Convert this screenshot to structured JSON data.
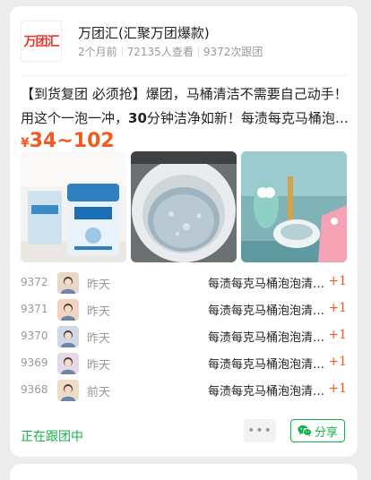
{
  "shop": {
    "logo_text": "万团汇",
    "name": "万团汇(汇聚万团爆款)",
    "posted": "2个月前",
    "views": "72135人查看",
    "follows": "9372次跟团"
  },
  "post": {
    "desc_prefix": "【到货复团 必须抢】爆团，马桶清洁不需要自己动手！用这个一泡一冲，",
    "desc_bold": "30",
    "desc_suffix": "分钟洁净如新！每渍每克马桶泡泡清洁剂",
    "price_currency": "¥",
    "price_range": "34~102"
  },
  "images": [
    {
      "name": "product-packages-image",
      "icon": "packages"
    },
    {
      "name": "toilet-bowl-image",
      "icon": "toilet"
    },
    {
      "name": "cartoon-toilet-image",
      "icon": "cartoon"
    }
  ],
  "orders": [
    {
      "no": "9372",
      "when": "昨天",
      "product": "每渍每克马桶泡泡清洁剂",
      "qty": "+1",
      "avatar_color": "#e6d7c6"
    },
    {
      "no": "9371",
      "when": "昨天",
      "product": "每渍每克马桶泡泡清洁剂",
      "qty": "+1",
      "avatar_color": "#f3d2c1"
    },
    {
      "no": "9370",
      "when": "昨天",
      "product": "每渍每克马桶泡泡清洁剂",
      "qty": "+1",
      "avatar_color": "#cfd8e6"
    },
    {
      "no": "9369",
      "when": "昨天",
      "product": "每渍每克马桶泡泡清洁剂",
      "qty": "+1",
      "avatar_color": "#e3d9e9"
    },
    {
      "no": "9368",
      "when": "前天",
      "product": "每渍每克马桶泡泡清洁剂",
      "qty": "+1",
      "avatar_color": "#ecdcc8"
    }
  ],
  "footer": {
    "following_label": "正在跟团中",
    "more_label": "•••",
    "share_label": "分享"
  },
  "colors": {
    "accent_green": "#17b14b",
    "price_orange": "#f25b1d"
  }
}
